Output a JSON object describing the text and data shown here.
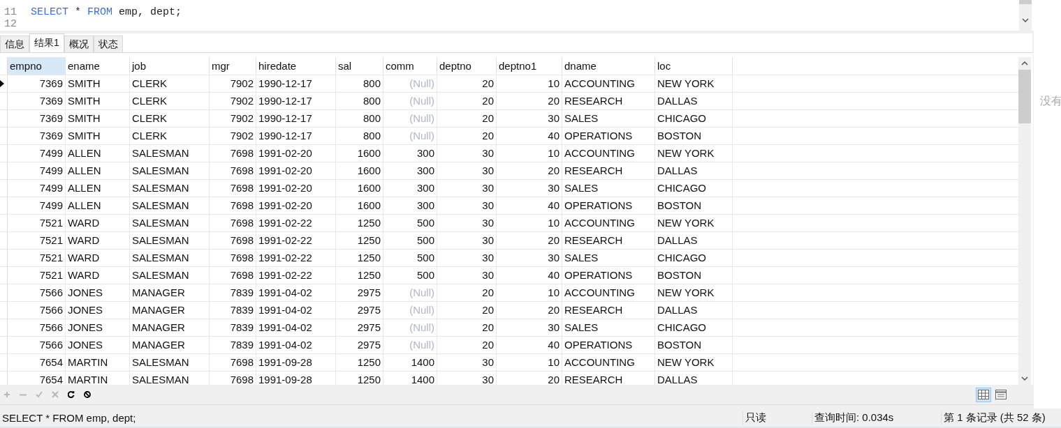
{
  "editor": {
    "lines": [
      {
        "number": "11",
        "code": [
          {
            "kind": "keyword",
            "text": "SELECT"
          },
          {
            "kind": "plain",
            "text": " * "
          },
          {
            "kind": "keyword",
            "text": "FROM"
          },
          {
            "kind": "plain",
            "text": " emp, dept;"
          }
        ]
      },
      {
        "number": "12"
      }
    ]
  },
  "tabs": [
    {
      "label": "信息",
      "selected": false
    },
    {
      "label": "结果1",
      "selected": true
    },
    {
      "label": "概况",
      "selected": false
    },
    {
      "label": "状态",
      "selected": false
    }
  ],
  "table": {
    "columns": [
      {
        "label": "empno",
        "selected": true
      },
      {
        "label": "ename",
        "selected": false
      },
      {
        "label": "job",
        "selected": false
      },
      {
        "label": "mgr",
        "selected": false
      },
      {
        "label": "hiredate",
        "selected": false
      },
      {
        "label": "sal",
        "selected": false
      },
      {
        "label": "comm",
        "selected": false
      },
      {
        "label": "deptno",
        "selected": false
      },
      {
        "label": "deptno1",
        "selected": false
      },
      {
        "label": "dname",
        "selected": false
      },
      {
        "label": "loc",
        "selected": false
      }
    ],
    "rows": [
      {
        "selected": true,
        "cells": [
          "7369",
          "SMITH",
          "CLERK",
          "7902",
          "1990-12-17",
          "800",
          {
            "text": "(Null)",
            "null": true
          },
          "20",
          "10",
          "ACCOUNTING",
          "NEW YORK"
        ]
      },
      {
        "selected": false,
        "cells": [
          "7369",
          "SMITH",
          "CLERK",
          "7902",
          "1990-12-17",
          "800",
          {
            "text": "(Null)",
            "null": true
          },
          "20",
          "20",
          "RESEARCH",
          "DALLAS"
        ]
      },
      {
        "selected": false,
        "cells": [
          "7369",
          "SMITH",
          "CLERK",
          "7902",
          "1990-12-17",
          "800",
          {
            "text": "(Null)",
            "null": true
          },
          "20",
          "30",
          "SALES",
          "CHICAGO"
        ]
      },
      {
        "selected": false,
        "cells": [
          "7369",
          "SMITH",
          "CLERK",
          "7902",
          "1990-12-17",
          "800",
          {
            "text": "(Null)",
            "null": true
          },
          "20",
          "40",
          "OPERATIONS",
          "BOSTON"
        ]
      },
      {
        "selected": false,
        "cells": [
          "7499",
          "ALLEN",
          "SALESMAN",
          "7698",
          "1991-02-20",
          "1600",
          "300",
          "30",
          "10",
          "ACCOUNTING",
          "NEW YORK"
        ]
      },
      {
        "selected": false,
        "cells": [
          "7499",
          "ALLEN",
          "SALESMAN",
          "7698",
          "1991-02-20",
          "1600",
          "300",
          "30",
          "20",
          "RESEARCH",
          "DALLAS"
        ]
      },
      {
        "selected": false,
        "cells": [
          "7499",
          "ALLEN",
          "SALESMAN",
          "7698",
          "1991-02-20",
          "1600",
          "300",
          "30",
          "30",
          "SALES",
          "CHICAGO"
        ]
      },
      {
        "selected": false,
        "cells": [
          "7499",
          "ALLEN",
          "SALESMAN",
          "7698",
          "1991-02-20",
          "1600",
          "300",
          "30",
          "40",
          "OPERATIONS",
          "BOSTON"
        ]
      },
      {
        "selected": false,
        "cells": [
          "7521",
          "WARD",
          "SALESMAN",
          "7698",
          "1991-02-22",
          "1250",
          "500",
          "30",
          "10",
          "ACCOUNTING",
          "NEW YORK"
        ]
      },
      {
        "selected": false,
        "cells": [
          "7521",
          "WARD",
          "SALESMAN",
          "7698",
          "1991-02-22",
          "1250",
          "500",
          "30",
          "20",
          "RESEARCH",
          "DALLAS"
        ]
      },
      {
        "selected": false,
        "cells": [
          "7521",
          "WARD",
          "SALESMAN",
          "7698",
          "1991-02-22",
          "1250",
          "500",
          "30",
          "30",
          "SALES",
          "CHICAGO"
        ]
      },
      {
        "selected": false,
        "cells": [
          "7521",
          "WARD",
          "SALESMAN",
          "7698",
          "1991-02-22",
          "1250",
          "500",
          "30",
          "40",
          "OPERATIONS",
          "BOSTON"
        ]
      },
      {
        "selected": false,
        "cells": [
          "7566",
          "JONES",
          "MANAGER",
          "7839",
          "1991-04-02",
          "2975",
          {
            "text": "(Null)",
            "null": true
          },
          "20",
          "10",
          "ACCOUNTING",
          "NEW YORK"
        ]
      },
      {
        "selected": false,
        "cells": [
          "7566",
          "JONES",
          "MANAGER",
          "7839",
          "1991-04-02",
          "2975",
          {
            "text": "(Null)",
            "null": true
          },
          "20",
          "20",
          "RESEARCH",
          "DALLAS"
        ]
      },
      {
        "selected": false,
        "cells": [
          "7566",
          "JONES",
          "MANAGER",
          "7839",
          "1991-04-02",
          "2975",
          {
            "text": "(Null)",
            "null": true
          },
          "20",
          "30",
          "SALES",
          "CHICAGO"
        ]
      },
      {
        "selected": false,
        "cells": [
          "7566",
          "JONES",
          "MANAGER",
          "7839",
          "1991-04-02",
          "2975",
          {
            "text": "(Null)",
            "null": true
          },
          "20",
          "40",
          "OPERATIONS",
          "BOSTON"
        ]
      },
      {
        "selected": false,
        "cells": [
          "7654",
          "MARTIN",
          "SALESMAN",
          "7698",
          "1991-09-28",
          "1250",
          "1400",
          "30",
          "10",
          "ACCOUNTING",
          "NEW YORK"
        ]
      },
      {
        "selected": false,
        "cells": [
          "7654",
          "MARTIN",
          "SALESMAN",
          "7698",
          "1991-09-28",
          "1250",
          "1400",
          "30",
          "20",
          "RESEARCH",
          "DALLAS"
        ]
      }
    ]
  },
  "toolbar": [
    {
      "kind": "add",
      "disabled": true
    },
    {
      "kind": "remove",
      "disabled": true
    },
    {
      "kind": "apply",
      "disabled": true
    },
    {
      "kind": "discard",
      "disabled": true
    },
    {
      "kind": "refresh",
      "disabled": false
    },
    {
      "kind": "stop",
      "disabled": false
    }
  ],
  "views": [
    {
      "kind": "grid",
      "selected": true
    },
    {
      "kind": "form",
      "selected": false
    }
  ],
  "side_text": "没有",
  "status_bar": {
    "query": "SELECT * FROM emp, dept;",
    "mode": "只读",
    "time": "查询时间: 0.034s",
    "record": "第 1 条记录 (共 52 条)"
  }
}
